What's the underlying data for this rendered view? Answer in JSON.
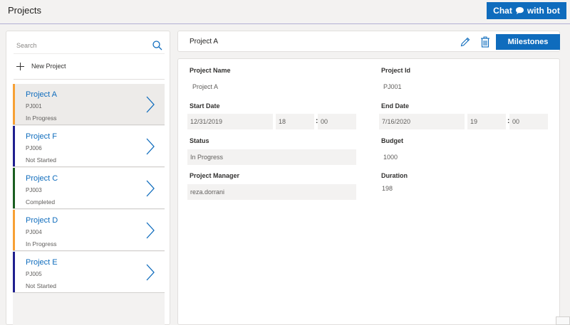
{
  "app": {
    "title": "Projects"
  },
  "header": {
    "chat_label_1": "Chat",
    "chat_label_2": "with bot",
    "chat_icon": "chat-bubble-icon"
  },
  "sidebar": {
    "search_placeholder": "Search",
    "new_project_label": "New Project",
    "projects": [
      {
        "name": "Project A",
        "id": "PJ001",
        "status": "In Progress",
        "color": "#f7a034",
        "selected": true
      },
      {
        "name": "Project F",
        "id": "PJ006",
        "status": "Not Started",
        "color": "#1f1f8f",
        "selected": false
      },
      {
        "name": "Project C",
        "id": "PJ003",
        "status": "Completed",
        "color": "#1b5e20",
        "selected": false
      },
      {
        "name": "Project D",
        "id": "PJ004",
        "status": "In Progress",
        "color": "#f7a034",
        "selected": false
      },
      {
        "name": "Project E",
        "id": "PJ005",
        "status": "Not Started",
        "color": "#1f1f8f",
        "selected": false
      }
    ]
  },
  "detail": {
    "title": "Project A",
    "milestones_label": "Milestones",
    "fields": {
      "project_name_label": "Project Name",
      "project_name": "Project A",
      "project_id_label": "Project Id",
      "project_id": "PJ001",
      "start_date_label": "Start Date",
      "start_date": "12/31/2019",
      "start_hour": "18",
      "start_min": "00",
      "end_date_label": "End Date",
      "end_date": "7/16/2020",
      "end_hour": "19",
      "end_min": "00",
      "status_label": "Status",
      "status": "In Progress",
      "budget_label": "Budget",
      "budget": "1000",
      "manager_label": "Project Manager",
      "manager": "reza.dorrani",
      "duration_label": "Duration",
      "duration": "198"
    },
    "colon": ":"
  },
  "colors": {
    "accent": "#0f6cbd"
  }
}
